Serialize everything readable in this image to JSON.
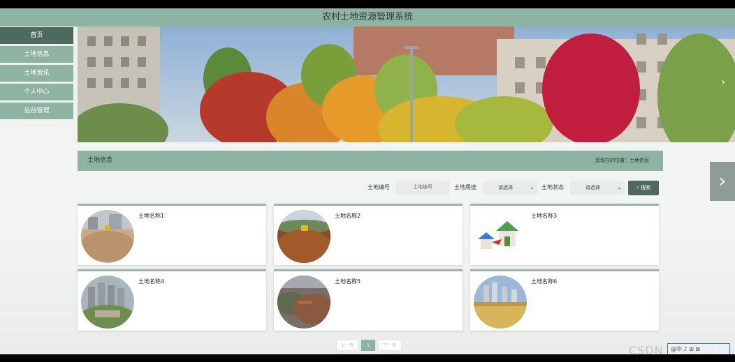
{
  "header": {
    "title": "农村土地资源管理系统"
  },
  "sidebar": {
    "items": [
      {
        "label": "首页"
      },
      {
        "label": "土地信息"
      },
      {
        "label": "土地资讯"
      },
      {
        "label": "个人中心"
      },
      {
        "label": "后台管理"
      }
    ]
  },
  "banner": {
    "next_icon": "chevron-right-icon"
  },
  "section": {
    "title": "土地信息",
    "breadcrumb": "您现在的位置：土地信息"
  },
  "filters": {
    "code_label": "土地编号",
    "code_placeholder": "土地编号",
    "usage_label": "土地用途",
    "usage_value": "请选择",
    "status_label": "土地状态",
    "status_value": "请选择",
    "search_label": "搜索"
  },
  "cards": [
    {
      "name": "土地名称1"
    },
    {
      "name": "土地名称2"
    },
    {
      "name": "土地名称3"
    },
    {
      "name": "土地名称4"
    },
    {
      "name": "土地名称5"
    },
    {
      "name": "土地名称6"
    }
  ],
  "pagination": {
    "prev": "上一页",
    "current": "1",
    "next": "下一页"
  },
  "watermark": "CSDN @W13026",
  "taskbar_chip": "@中 ♪ ⊞ ⊠"
}
